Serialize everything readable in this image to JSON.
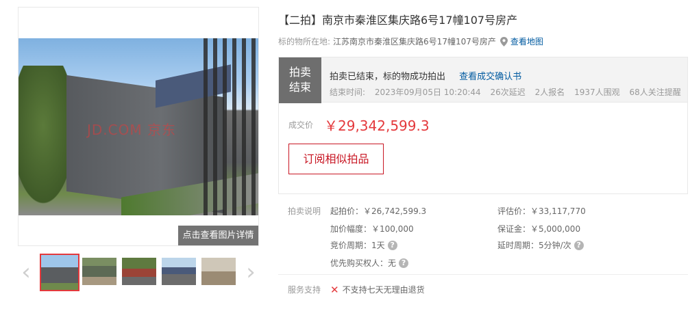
{
  "gallery": {
    "watermark": "JD.COM 京东",
    "detail_button": "点击查看图片详情",
    "prev_arrow": "‹",
    "next_arrow": "›",
    "thumbnails": [
      "thumb-1",
      "thumb-2",
      "thumb-3",
      "thumb-4",
      "thumb-5"
    ],
    "selected_index": 0
  },
  "header": {
    "title": "【二拍】南京市秦淮区集庆路6号17幢107号房产",
    "location_label": "标的物所在地:",
    "location_value": "江苏南京市秦淮区集庆路6号17幢107号房产",
    "map_link": "查看地图"
  },
  "status": {
    "badge_line1": "拍卖",
    "badge_line2": "结束",
    "message": "拍卖已结束，标的物成功拍出",
    "confirm_link": "查看成交确认书",
    "end_time_label": "结束时间:",
    "end_time_value": "2023年09月05日 10:20:44",
    "delays": "26次延迟",
    "registrations": "2人报名",
    "views": "1937人围观",
    "followers": "68人关注提醒"
  },
  "price": {
    "label": "成交价",
    "value": "￥29,342,599.3",
    "subscribe_button": "订阅相似拍品"
  },
  "auction_info": {
    "section_title": "拍卖说明",
    "starting_price": "起拍价：￥26,742,599.3",
    "appraisal": "评估价：￥33,117,770",
    "increment": "加价幅度：￥100,000",
    "deposit": "保证金：￥5,000,000",
    "bid_period": "竞价周期：1天",
    "delay_period": "延时周期：5分钟/次",
    "priority_buyer": "优先购买权人：无",
    "help_glyph": "?"
  },
  "service": {
    "label": "服务支持",
    "icon": "✕",
    "item": "不支持七天无理由退货"
  },
  "colors": {
    "accent_red": "#e4393c",
    "link_blue": "#005aa0",
    "badge_gray": "#6e6e6e"
  }
}
